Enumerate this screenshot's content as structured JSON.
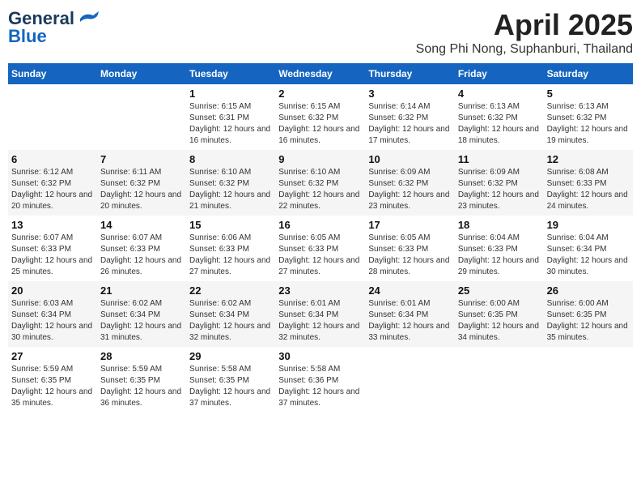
{
  "header": {
    "logo_line1": "General",
    "logo_line2": "Blue",
    "month_year": "April 2025",
    "location": "Song Phi Nong, Suphanburi, Thailand"
  },
  "days_of_week": [
    "Sunday",
    "Monday",
    "Tuesday",
    "Wednesday",
    "Thursday",
    "Friday",
    "Saturday"
  ],
  "weeks": [
    [
      {
        "num": "",
        "info": ""
      },
      {
        "num": "",
        "info": ""
      },
      {
        "num": "1",
        "info": "Sunrise: 6:15 AM\nSunset: 6:31 PM\nDaylight: 12 hours and 16 minutes."
      },
      {
        "num": "2",
        "info": "Sunrise: 6:15 AM\nSunset: 6:32 PM\nDaylight: 12 hours and 16 minutes."
      },
      {
        "num": "3",
        "info": "Sunrise: 6:14 AM\nSunset: 6:32 PM\nDaylight: 12 hours and 17 minutes."
      },
      {
        "num": "4",
        "info": "Sunrise: 6:13 AM\nSunset: 6:32 PM\nDaylight: 12 hours and 18 minutes."
      },
      {
        "num": "5",
        "info": "Sunrise: 6:13 AM\nSunset: 6:32 PM\nDaylight: 12 hours and 19 minutes."
      }
    ],
    [
      {
        "num": "6",
        "info": "Sunrise: 6:12 AM\nSunset: 6:32 PM\nDaylight: 12 hours and 20 minutes."
      },
      {
        "num": "7",
        "info": "Sunrise: 6:11 AM\nSunset: 6:32 PM\nDaylight: 12 hours and 20 minutes."
      },
      {
        "num": "8",
        "info": "Sunrise: 6:10 AM\nSunset: 6:32 PM\nDaylight: 12 hours and 21 minutes."
      },
      {
        "num": "9",
        "info": "Sunrise: 6:10 AM\nSunset: 6:32 PM\nDaylight: 12 hours and 22 minutes."
      },
      {
        "num": "10",
        "info": "Sunrise: 6:09 AM\nSunset: 6:32 PM\nDaylight: 12 hours and 23 minutes."
      },
      {
        "num": "11",
        "info": "Sunrise: 6:09 AM\nSunset: 6:32 PM\nDaylight: 12 hours and 23 minutes."
      },
      {
        "num": "12",
        "info": "Sunrise: 6:08 AM\nSunset: 6:33 PM\nDaylight: 12 hours and 24 minutes."
      }
    ],
    [
      {
        "num": "13",
        "info": "Sunrise: 6:07 AM\nSunset: 6:33 PM\nDaylight: 12 hours and 25 minutes."
      },
      {
        "num": "14",
        "info": "Sunrise: 6:07 AM\nSunset: 6:33 PM\nDaylight: 12 hours and 26 minutes."
      },
      {
        "num": "15",
        "info": "Sunrise: 6:06 AM\nSunset: 6:33 PM\nDaylight: 12 hours and 27 minutes."
      },
      {
        "num": "16",
        "info": "Sunrise: 6:05 AM\nSunset: 6:33 PM\nDaylight: 12 hours and 27 minutes."
      },
      {
        "num": "17",
        "info": "Sunrise: 6:05 AM\nSunset: 6:33 PM\nDaylight: 12 hours and 28 minutes."
      },
      {
        "num": "18",
        "info": "Sunrise: 6:04 AM\nSunset: 6:33 PM\nDaylight: 12 hours and 29 minutes."
      },
      {
        "num": "19",
        "info": "Sunrise: 6:04 AM\nSunset: 6:34 PM\nDaylight: 12 hours and 30 minutes."
      }
    ],
    [
      {
        "num": "20",
        "info": "Sunrise: 6:03 AM\nSunset: 6:34 PM\nDaylight: 12 hours and 30 minutes."
      },
      {
        "num": "21",
        "info": "Sunrise: 6:02 AM\nSunset: 6:34 PM\nDaylight: 12 hours and 31 minutes."
      },
      {
        "num": "22",
        "info": "Sunrise: 6:02 AM\nSunset: 6:34 PM\nDaylight: 12 hours and 32 minutes."
      },
      {
        "num": "23",
        "info": "Sunrise: 6:01 AM\nSunset: 6:34 PM\nDaylight: 12 hours and 32 minutes."
      },
      {
        "num": "24",
        "info": "Sunrise: 6:01 AM\nSunset: 6:34 PM\nDaylight: 12 hours and 33 minutes."
      },
      {
        "num": "25",
        "info": "Sunrise: 6:00 AM\nSunset: 6:35 PM\nDaylight: 12 hours and 34 minutes."
      },
      {
        "num": "26",
        "info": "Sunrise: 6:00 AM\nSunset: 6:35 PM\nDaylight: 12 hours and 35 minutes."
      }
    ],
    [
      {
        "num": "27",
        "info": "Sunrise: 5:59 AM\nSunset: 6:35 PM\nDaylight: 12 hours and 35 minutes."
      },
      {
        "num": "28",
        "info": "Sunrise: 5:59 AM\nSunset: 6:35 PM\nDaylight: 12 hours and 36 minutes."
      },
      {
        "num": "29",
        "info": "Sunrise: 5:58 AM\nSunset: 6:35 PM\nDaylight: 12 hours and 37 minutes."
      },
      {
        "num": "30",
        "info": "Sunrise: 5:58 AM\nSunset: 6:36 PM\nDaylight: 12 hours and 37 minutes."
      },
      {
        "num": "",
        "info": ""
      },
      {
        "num": "",
        "info": ""
      },
      {
        "num": "",
        "info": ""
      }
    ]
  ]
}
